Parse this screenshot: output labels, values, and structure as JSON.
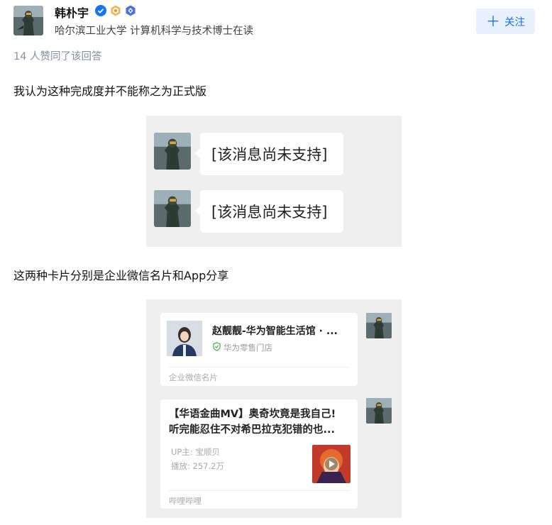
{
  "author": {
    "name": "韩朴宇",
    "bio": "哈尔滨工业大学 计算机科学与技术博士在读",
    "badges": [
      "verified-icon",
      "honor-badge-icon",
      "creator-badge-icon"
    ]
  },
  "follow_button": {
    "icon": "plus-icon",
    "label": "关注"
  },
  "upvote_info": "14 人赞同了该回答",
  "paragraphs": [
    "我认为这种完成度并不能称之为正式版",
    "这两种卡片分别是企业微信名片和App分享"
  ],
  "chat_screenshot": {
    "messages": [
      "[该消息尚未支持]",
      "[该消息尚未支持]"
    ]
  },
  "cards_screenshot": {
    "contact_card": {
      "name": "赵靓靓-华为智能生活馆 · ...",
      "shop": "华为零售门店",
      "footer": "企业微信名片"
    },
    "app_card": {
      "title_line1": "【华语金曲MV】奥奇坎竟是我自己!",
      "title_line2": "听完能忍住不对希巴拉克犯错的也...",
      "uploader": "UP主: 宝顺贝",
      "plays": "播放: 257.2万",
      "footer": "哔哩哔哩"
    }
  },
  "colors": {
    "accent": "#1772f6",
    "follow_bg": "#e8f1fd",
    "muted": "#8590a6",
    "screenshot_bg": "#efefef"
  }
}
